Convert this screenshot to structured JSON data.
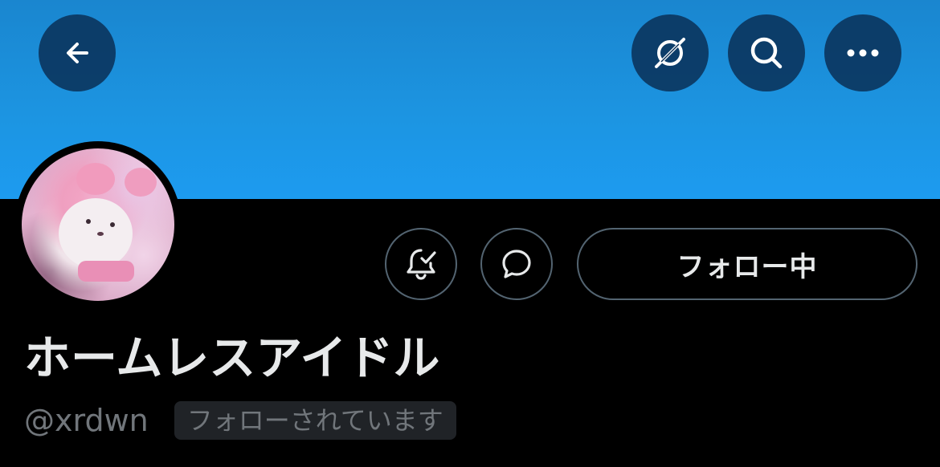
{
  "profile": {
    "display_name": "ホームレスアイドル",
    "handle": "@xrdwn",
    "follows_you_badge": "フォローされています"
  },
  "actions": {
    "follow_button_label": "フォロー中"
  },
  "header": {
    "icons": [
      "back-arrow-icon",
      "explore-icon",
      "search-icon",
      "more-icon"
    ]
  },
  "buttons": {
    "notify_icon": "bell-check-icon",
    "dm_icon": "message-bubble-icon"
  },
  "colors": {
    "banner": "#1d9bf0",
    "background": "#000000",
    "header_button": "#0a325a",
    "outline": "#536471",
    "primary_text": "#e7e9ea",
    "secondary_text": "#71767b",
    "badge_bg": "#202327"
  }
}
